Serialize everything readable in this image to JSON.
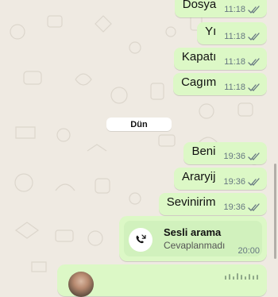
{
  "messages": [
    {
      "text": "Dosya",
      "time": "11:18"
    },
    {
      "text": "Yı",
      "time": "11:18"
    },
    {
      "text": "Kapatı",
      "time": "11:18"
    },
    {
      "text": "Cagım",
      "time": "11:18"
    },
    {
      "text": "Beni",
      "time": "19:36"
    },
    {
      "text": "Araryij",
      "time": "19:36"
    },
    {
      "text": "Sevinirim",
      "time": "19:36"
    }
  ],
  "date_divider": "Dün",
  "call": {
    "title": "Sesli arama",
    "status": "Cevaplanmadı",
    "time": "20:00"
  },
  "icons": {
    "read_receipt": "double-check-icon",
    "call": "missed-call-icon",
    "voice_avatar": "avatar",
    "voice_wave": "waveform-icon"
  },
  "colors": {
    "background": "#efeae2",
    "outgoing_bubble": "#dcf8c6",
    "time_text": "#667781",
    "ticks": "#667781"
  }
}
